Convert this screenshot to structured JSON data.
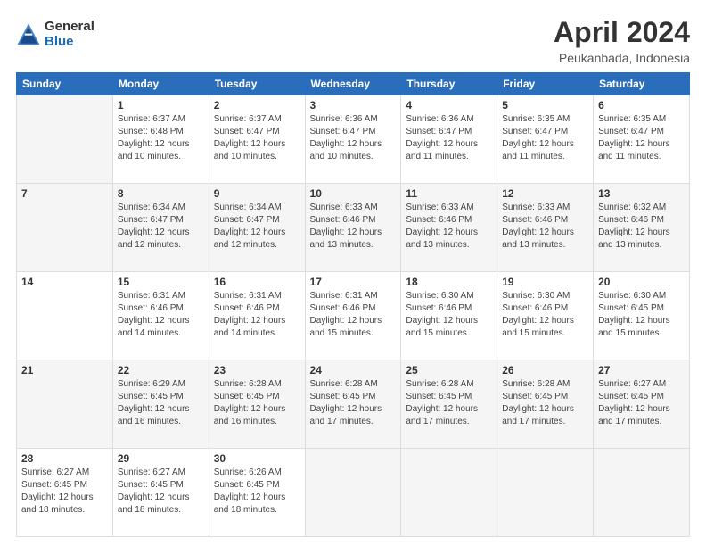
{
  "header": {
    "logo_general": "General",
    "logo_blue": "Blue",
    "title": "April 2024",
    "subtitle": "Peukanbada, Indonesia"
  },
  "calendar": {
    "days_of_week": [
      "Sunday",
      "Monday",
      "Tuesday",
      "Wednesday",
      "Thursday",
      "Friday",
      "Saturday"
    ],
    "weeks": [
      [
        {
          "day": "",
          "detail": ""
        },
        {
          "day": "1",
          "detail": "Sunrise: 6:37 AM\nSunset: 6:48 PM\nDaylight: 12 hours\nand 10 minutes."
        },
        {
          "day": "2",
          "detail": "Sunrise: 6:37 AM\nSunset: 6:47 PM\nDaylight: 12 hours\nand 10 minutes."
        },
        {
          "day": "3",
          "detail": "Sunrise: 6:36 AM\nSunset: 6:47 PM\nDaylight: 12 hours\nand 10 minutes."
        },
        {
          "day": "4",
          "detail": "Sunrise: 6:36 AM\nSunset: 6:47 PM\nDaylight: 12 hours\nand 11 minutes."
        },
        {
          "day": "5",
          "detail": "Sunrise: 6:35 AM\nSunset: 6:47 PM\nDaylight: 12 hours\nand 11 minutes."
        },
        {
          "day": "6",
          "detail": "Sunrise: 6:35 AM\nSunset: 6:47 PM\nDaylight: 12 hours\nand 11 minutes."
        }
      ],
      [
        {
          "day": "7",
          "detail": ""
        },
        {
          "day": "8",
          "detail": "Sunrise: 6:34 AM\nSunset: 6:47 PM\nDaylight: 12 hours\nand 12 minutes."
        },
        {
          "day": "9",
          "detail": "Sunrise: 6:34 AM\nSunset: 6:47 PM\nDaylight: 12 hours\nand 12 minutes."
        },
        {
          "day": "10",
          "detail": "Sunrise: 6:33 AM\nSunset: 6:46 PM\nDaylight: 12 hours\nand 13 minutes."
        },
        {
          "day": "11",
          "detail": "Sunrise: 6:33 AM\nSunset: 6:46 PM\nDaylight: 12 hours\nand 13 minutes."
        },
        {
          "day": "12",
          "detail": "Sunrise: 6:33 AM\nSunset: 6:46 PM\nDaylight: 12 hours\nand 13 minutes."
        },
        {
          "day": "13",
          "detail": "Sunrise: 6:32 AM\nSunset: 6:46 PM\nDaylight: 12 hours\nand 13 minutes."
        }
      ],
      [
        {
          "day": "14",
          "detail": ""
        },
        {
          "day": "15",
          "detail": "Sunrise: 6:31 AM\nSunset: 6:46 PM\nDaylight: 12 hours\nand 14 minutes."
        },
        {
          "day": "16",
          "detail": "Sunrise: 6:31 AM\nSunset: 6:46 PM\nDaylight: 12 hours\nand 14 minutes."
        },
        {
          "day": "17",
          "detail": "Sunrise: 6:31 AM\nSunset: 6:46 PM\nDaylight: 12 hours\nand 15 minutes."
        },
        {
          "day": "18",
          "detail": "Sunrise: 6:30 AM\nSunset: 6:46 PM\nDaylight: 12 hours\nand 15 minutes."
        },
        {
          "day": "19",
          "detail": "Sunrise: 6:30 AM\nSunset: 6:46 PM\nDaylight: 12 hours\nand 15 minutes."
        },
        {
          "day": "20",
          "detail": "Sunrise: 6:30 AM\nSunset: 6:45 PM\nDaylight: 12 hours\nand 15 minutes."
        }
      ],
      [
        {
          "day": "21",
          "detail": ""
        },
        {
          "day": "22",
          "detail": "Sunrise: 6:29 AM\nSunset: 6:45 PM\nDaylight: 12 hours\nand 16 minutes."
        },
        {
          "day": "23",
          "detail": "Sunrise: 6:28 AM\nSunset: 6:45 PM\nDaylight: 12 hours\nand 16 minutes."
        },
        {
          "day": "24",
          "detail": "Sunrise: 6:28 AM\nSunset: 6:45 PM\nDaylight: 12 hours\nand 17 minutes."
        },
        {
          "day": "25",
          "detail": "Sunrise: 6:28 AM\nSunset: 6:45 PM\nDaylight: 12 hours\nand 17 minutes."
        },
        {
          "day": "26",
          "detail": "Sunrise: 6:28 AM\nSunset: 6:45 PM\nDaylight: 12 hours\nand 17 minutes."
        },
        {
          "day": "27",
          "detail": "Sunrise: 6:27 AM\nSunset: 6:45 PM\nDaylight: 12 hours\nand 17 minutes."
        }
      ],
      [
        {
          "day": "28",
          "detail": "Sunrise: 6:27 AM\nSunset: 6:45 PM\nDaylight: 12 hours\nand 18 minutes."
        },
        {
          "day": "29",
          "detail": "Sunrise: 6:27 AM\nSunset: 6:45 PM\nDaylight: 12 hours\nand 18 minutes."
        },
        {
          "day": "30",
          "detail": "Sunrise: 6:26 AM\nSunset: 6:45 PM\nDaylight: 12 hours\nand 18 minutes."
        },
        {
          "day": "",
          "detail": ""
        },
        {
          "day": "",
          "detail": ""
        },
        {
          "day": "",
          "detail": ""
        },
        {
          "day": "",
          "detail": ""
        }
      ]
    ]
  }
}
